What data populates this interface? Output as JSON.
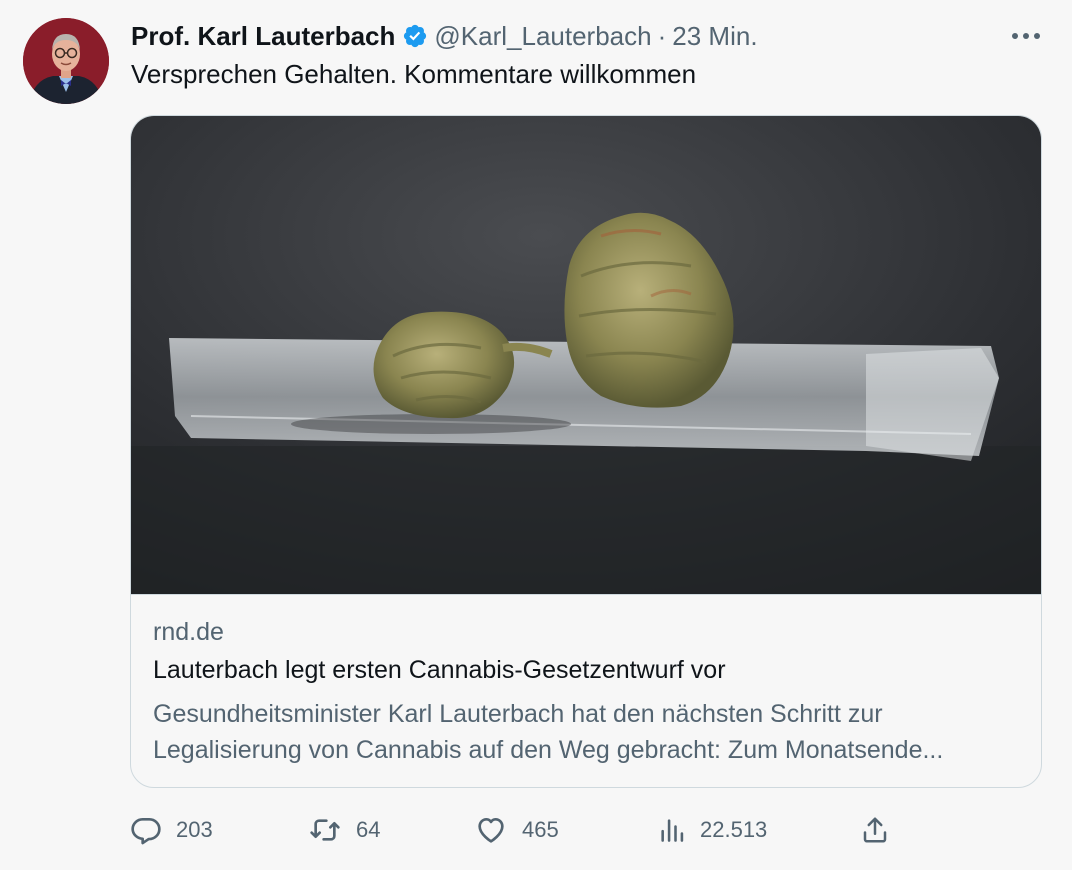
{
  "tweet": {
    "author_name": "Prof. Karl Lauterbach",
    "handle": "@Karl_Lauterbach",
    "separator": "·",
    "time": "23 Min.",
    "text": "Versprechen Gehalten. Kommentare willkommen"
  },
  "card": {
    "domain": "rnd.de",
    "headline": "Lauterbach legt ersten Cannabis-Gesetzentwurf vor",
    "description_line1": "Gesundheitsminister Karl Lauterbach hat den nächsten Schritt zur",
    "description_line2": "Legalisierung von Cannabis auf den Weg gebracht: Zum Monatsende..."
  },
  "actions": {
    "replies": "203",
    "retweets": "64",
    "likes": "465",
    "views": "22.513"
  },
  "icons": {
    "verified": "verified-badge-icon",
    "more": "more-icon",
    "reply": "reply-icon",
    "retweet": "retweet-icon",
    "like": "heart-icon",
    "views": "views-icon",
    "share": "share-icon"
  },
  "colors": {
    "verified_blue": "#1d9bf0",
    "secondary_text": "#536471",
    "border": "#cfd9de",
    "avatar_background": "#8a1d2a"
  }
}
